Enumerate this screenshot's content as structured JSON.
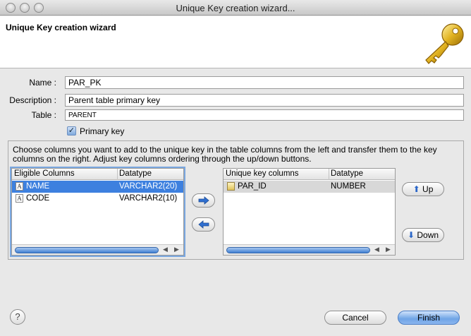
{
  "window": {
    "title": "Unique Key creation wizard..."
  },
  "banner": {
    "title": "Unique Key creation wizard",
    "icon": "key-icon"
  },
  "form": {
    "name_label": "Name :",
    "name_value": "PAR_PK",
    "description_label": "Description :",
    "description_value": "Parent table primary key",
    "table_label": "Table :",
    "table_value": "PARENT",
    "primary_key_label": "Primary key",
    "primary_key_checked": true
  },
  "instructions": "Choose columns you want to add to the unique key in the table columns from the left and transfer them to the key columns on the right. Adjust key columns ordering through the up/down buttons.",
  "eligible": {
    "headers": [
      "Eligible Columns",
      "Datatype"
    ],
    "rows": [
      {
        "name": "NAME",
        "type": "VARCHAR2(20)",
        "selected": true
      },
      {
        "name": "CODE",
        "type": "VARCHAR2(10)",
        "selected": false
      }
    ]
  },
  "keycols": {
    "headers": [
      "Unique key columns",
      "Datatype"
    ],
    "rows": [
      {
        "name": "PAR_ID",
        "type": "NUMBER",
        "selected": true
      }
    ]
  },
  "buttons": {
    "add_icon": "arrow-right-icon",
    "remove_icon": "arrow-left-icon",
    "up": "Up",
    "down": "Down",
    "cancel": "Cancel",
    "finish": "Finish",
    "help": "?"
  },
  "colors": {
    "selection": "#3d80df",
    "accent": "#6fa4e6"
  }
}
